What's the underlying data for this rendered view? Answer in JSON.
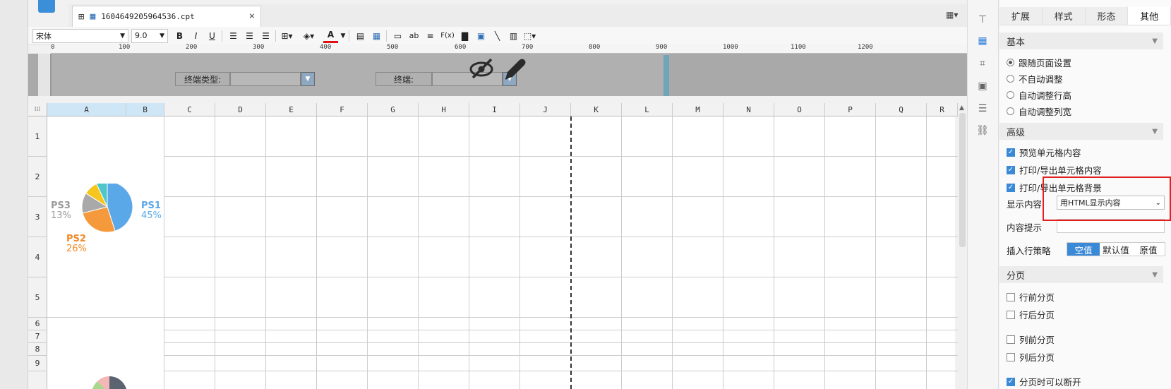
{
  "window": {
    "doc_tab_title": "1604649205964536.cpt",
    "close_glyph": "×"
  },
  "toolbar": {
    "font_name": "宋体",
    "font_size": "9.0",
    "bold": "B",
    "italic": "I",
    "underline": "U",
    "text_color_glyph": "A",
    "fx_label": "F(x)",
    "ab_label": "ab"
  },
  "ruler": {
    "ticks": [
      "0",
      "100",
      "200",
      "300",
      "400",
      "500",
      "600",
      "700",
      "800",
      "900",
      "1000",
      "1100",
      "1200"
    ]
  },
  "params": {
    "terminal_type_label": "终端类型:",
    "terminal_label": "终端:"
  },
  "grid": {
    "columns": [
      "A",
      "B",
      "C",
      "D",
      "E",
      "F",
      "G",
      "H",
      "I",
      "J",
      "K",
      "L",
      "M",
      "N",
      "O",
      "P",
      "Q",
      "R"
    ],
    "rows": [
      "1",
      "2",
      "3",
      "4",
      "5",
      "6",
      "7",
      "8",
      "9"
    ]
  },
  "chart_data": {
    "type": "pie",
    "labels": [
      "PS1",
      "PS2",
      "PS3",
      "",
      ""
    ],
    "values": [
      45,
      26,
      13,
      9,
      7
    ],
    "value_labels": [
      "45%",
      "26%",
      "13%",
      "",
      ""
    ],
    "colors": [
      "#5ba8e8",
      "#f59a3c",
      "#a9a9a9",
      "#f7c61e",
      "#4fc7c9"
    ]
  },
  "panel": {
    "tabs": [
      "扩展",
      "样式",
      "形态",
      "其他"
    ],
    "active_tab": "其他",
    "basic": {
      "title": "基本",
      "options": [
        "跟随页面设置",
        "不自动调整",
        "自动调整行高",
        "自动调整列宽"
      ],
      "selected_index": 0
    },
    "advanced": {
      "title": "高级",
      "checkboxes": [
        "预览单元格内容",
        "打印/导出单元格内容",
        "打印/导出单元格背景"
      ],
      "display_label": "显示内容",
      "display_value": "用HTML显示内容",
      "hint_label": "内容提示",
      "insert_label": "插入行策略",
      "insert_options": [
        "空值",
        "默认值",
        "原值"
      ],
      "insert_selected": "空值"
    },
    "paging": {
      "title": "分页",
      "options": [
        "行前分页",
        "行后分页",
        "列前分页",
        "列后分页",
        "分页时可以断开"
      ],
      "checked": [
        false,
        false,
        false,
        false,
        true
      ]
    }
  }
}
